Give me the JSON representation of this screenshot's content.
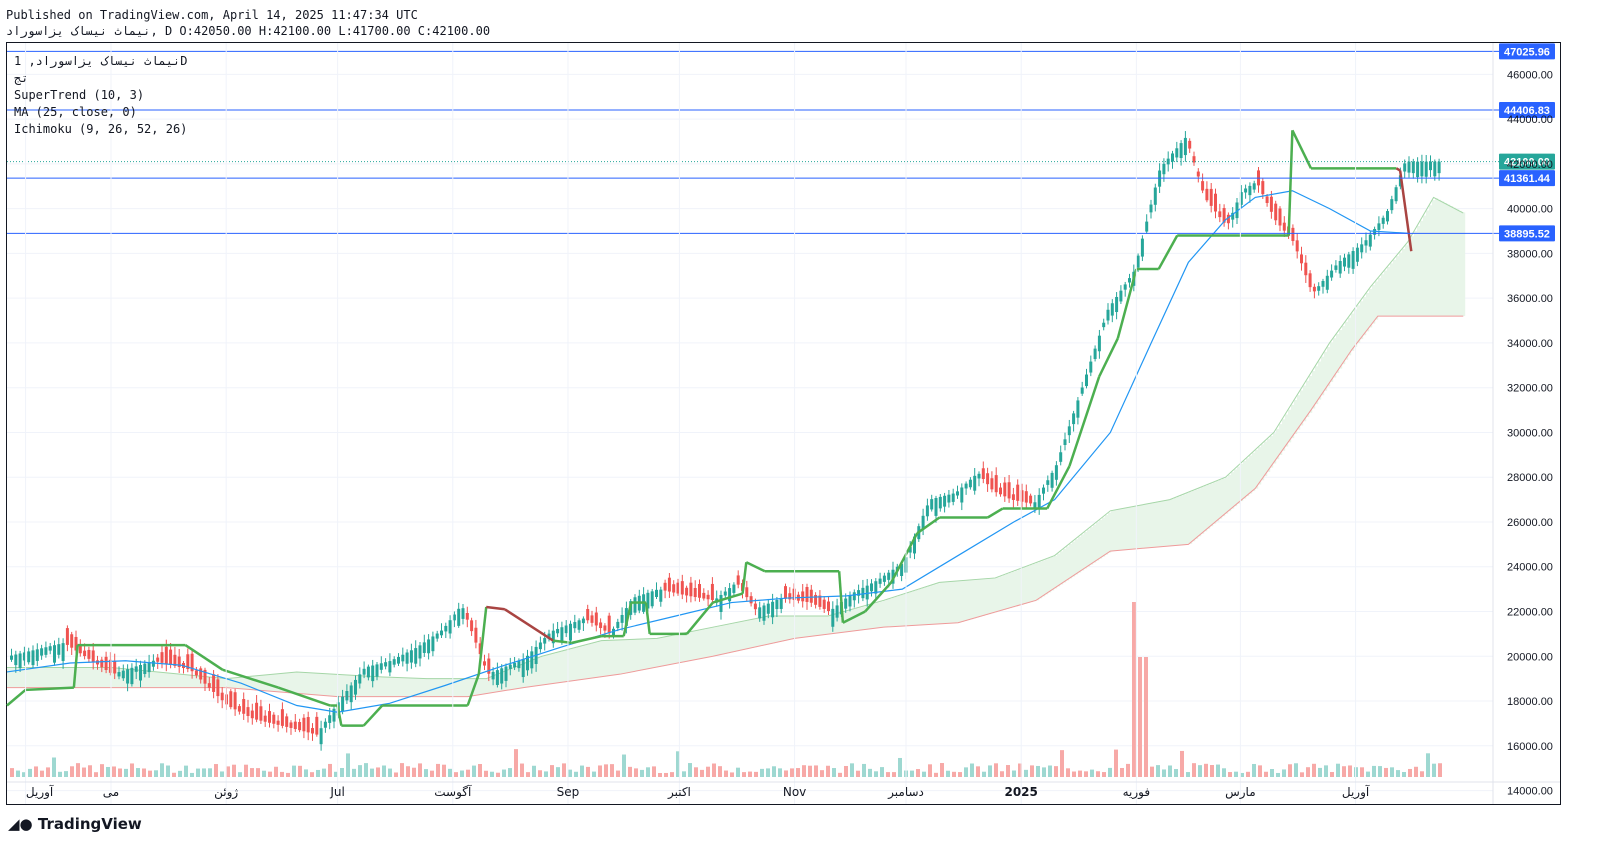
{
  "header": {
    "published": "Published on TradingView.com, April 14, 2025 11:47:34 UTC",
    "ohlc": "نیماث نیساک یزاسوراد, D O:42050.00 H:42100.00 L:41700.00 C:42100.00"
  },
  "legend": {
    "symbol": "نیماث نیساک یزاسوراد, 1D",
    "exchange": "تج",
    "supertrend": "SuperTrend (10, 3)",
    "ma": "MA (25, close, 0)",
    "ichimoku": "Ichimoku (9, 26, 52, 26)"
  },
  "logo": "TradingView",
  "colors": {
    "up": "#26a69a",
    "down": "#ef5350",
    "supertrend_up": "#4caf50",
    "supertrend_down": "#a94442",
    "ma": "#2196f3",
    "hline": "#2962ff",
    "cloud_green": "#e8f5e9",
    "cloud_red": "#fde8e8"
  },
  "chart_data": {
    "type": "candlestick",
    "symbol": "نیماث نیساک یزاسوراد",
    "interval": "1D",
    "ylim": [
      13400,
      47400
    ],
    "y_ticks": [
      14000,
      16000,
      18000,
      20000,
      22000,
      24000,
      26000,
      28000,
      30000,
      32000,
      34000,
      36000,
      38000,
      40000,
      42000,
      44000,
      46000
    ],
    "x_labels": [
      "آوریل",
      "می",
      "ژوئن",
      "Jul",
      "آگوست",
      "Sep",
      "اکتبر",
      "Nov",
      "دسامبر",
      "2025",
      "فوریه",
      "مارس",
      "آوریل"
    ],
    "price_lines": [
      {
        "value": 47025.96,
        "label": "47025.96"
      },
      {
        "value": 44406.83,
        "label": "44406.83"
      },
      {
        "value": 41361.44,
        "label": "41361.44"
      },
      {
        "value": 38895.52,
        "label": "38895.52"
      }
    ],
    "last_price": {
      "value": 42100,
      "label": "42100.00"
    },
    "series": [
      {
        "name": "price",
        "points": [
          [
            "2024-04-08",
            20200
          ],
          [
            "2024-04-18",
            20600
          ],
          [
            "2024-05-01",
            19200
          ],
          [
            "2024-05-12",
            19800
          ],
          [
            "2024-05-22",
            19400
          ],
          [
            "2024-06-01",
            17800
          ],
          [
            "2024-06-08",
            17200
          ],
          [
            "2024-06-18",
            16800
          ],
          [
            "2024-06-25",
            16500
          ],
          [
            "2024-07-01",
            18000
          ],
          [
            "2024-07-08",
            19500
          ],
          [
            "2024-07-15",
            19800
          ],
          [
            "2024-07-22",
            20400
          ],
          [
            "2024-07-29",
            21200
          ],
          [
            "2024-08-03",
            22300
          ],
          [
            "2024-08-10",
            19200
          ],
          [
            "2024-08-20",
            19900
          ],
          [
            "2024-08-27",
            21100
          ],
          [
            "2024-09-05",
            21700
          ],
          [
            "2024-09-12",
            21000
          ],
          [
            "2024-09-18",
            22600
          ],
          [
            "2024-09-25",
            23000
          ],
          [
            "2024-10-03",
            22700
          ],
          [
            "2024-10-10",
            22500
          ],
          [
            "2024-10-16",
            23300
          ],
          [
            "2024-10-21",
            22100
          ],
          [
            "2024-10-28",
            22600
          ],
          [
            "2024-11-05",
            22400
          ],
          [
            "2024-11-10",
            22000
          ],
          [
            "2024-11-16",
            22800
          ],
          [
            "2024-11-23",
            23400
          ],
          [
            "2024-11-30",
            24200
          ],
          [
            "2024-12-07",
            27000
          ],
          [
            "2024-12-14",
            27300
          ],
          [
            "2024-12-20",
            28200
          ],
          [
            "2024-12-24",
            27400
          ],
          [
            "2024-12-29",
            27000
          ],
          [
            "2025-01-04",
            26800
          ],
          [
            "2025-01-10",
            28500
          ],
          [
            "2025-01-17",
            32000
          ],
          [
            "2025-01-24",
            35500
          ],
          [
            "2025-01-31",
            37200
          ],
          [
            "2025-02-07",
            41800
          ],
          [
            "2025-02-14",
            43200
          ],
          [
            "2025-02-19",
            40500
          ],
          [
            "2025-02-25",
            39200
          ],
          [
            "2025-03-01",
            40800
          ],
          [
            "2025-03-05",
            41200
          ],
          [
            "2025-03-10",
            39500
          ],
          [
            "2025-03-15",
            38500
          ],
          [
            "2025-03-20",
            36200
          ],
          [
            "2025-03-27",
            37600
          ],
          [
            "2025-04-03",
            38500
          ],
          [
            "2025-04-09",
            39800
          ],
          [
            "2025-04-14",
            42100
          ]
        ]
      },
      {
        "name": "SuperTrend",
        "points": [
          [
            "2024-04-03",
            17800
          ],
          [
            "2024-04-08",
            18500
          ],
          [
            "2024-04-21",
            18600
          ],
          [
            "2024-04-22",
            20500
          ],
          [
            "2024-05-21",
            20500
          ],
          [
            "2024-05-31",
            19400
          ],
          [
            "2024-06-15",
            18600
          ],
          [
            "2024-06-29",
            17800
          ],
          [
            "2024-07-01",
            17800
          ],
          [
            "2024-07-02",
            16900
          ],
          [
            "2024-07-08",
            16900
          ],
          [
            "2024-07-13",
            17800
          ],
          [
            "2024-08-05",
            17800
          ],
          [
            "2024-08-08",
            19200
          ],
          [
            "2024-08-10",
            22200
          ],
          [
            "2024-08-15",
            22100
          ],
          [
            "2024-08-28",
            20700
          ],
          [
            "2024-09-02",
            20600
          ],
          [
            "2024-09-10",
            20900
          ],
          [
            "2024-09-16",
            20900
          ],
          [
            "2024-09-18",
            22400
          ],
          [
            "2024-09-22",
            22400
          ],
          [
            "2024-09-23",
            21000
          ],
          [
            "2024-10-03",
            21000
          ],
          [
            "2024-10-10",
            22400
          ],
          [
            "2024-10-18",
            22800
          ],
          [
            "2024-10-19",
            24200
          ],
          [
            "2024-10-24",
            23800
          ],
          [
            "2024-11-13",
            23800
          ],
          [
            "2024-11-14",
            21500
          ],
          [
            "2024-11-20",
            22000
          ],
          [
            "2024-11-27",
            23300
          ],
          [
            "2024-12-04",
            25500
          ],
          [
            "2024-12-10",
            26200
          ],
          [
            "2024-12-23",
            26200
          ],
          [
            "2024-12-27",
            26600
          ],
          [
            "2025-01-08",
            26600
          ],
          [
            "2025-01-14",
            28500
          ],
          [
            "2025-01-22",
            32500
          ],
          [
            "2025-01-27",
            34200
          ],
          [
            "2025-02-01",
            37300
          ],
          [
            "2025-02-07",
            37300
          ],
          [
            "2025-02-12",
            38800
          ],
          [
            "2025-03-14",
            38800
          ],
          [
            "2025-03-15",
            43500
          ],
          [
            "2025-03-20",
            41800
          ],
          [
            "2025-04-12",
            41800
          ],
          [
            "2025-04-13",
            41700
          ],
          [
            "2025-04-16",
            38100
          ]
        ]
      },
      {
        "name": "MA",
        "points": [
          [
            "2024-04-03",
            19300
          ],
          [
            "2024-04-20",
            19700
          ],
          [
            "2024-05-05",
            19800
          ],
          [
            "2024-05-20",
            19600
          ],
          [
            "2024-06-05",
            18800
          ],
          [
            "2024-06-20",
            17800
          ],
          [
            "2024-07-01",
            17500
          ],
          [
            "2024-07-15",
            17900
          ],
          [
            "2024-07-30",
            18700
          ],
          [
            "2024-08-15",
            19600
          ],
          [
            "2024-08-30",
            20400
          ],
          [
            "2024-09-15",
            21200
          ],
          [
            "2024-09-30",
            21800
          ],
          [
            "2024-10-15",
            22400
          ],
          [
            "2024-10-30",
            22600
          ],
          [
            "2024-11-15",
            22700
          ],
          [
            "2024-11-30",
            23000
          ],
          [
            "2024-12-15",
            24500
          ],
          [
            "2024-12-30",
            26000
          ],
          [
            "2025-01-10",
            27000
          ],
          [
            "2025-01-25",
            30000
          ],
          [
            "2025-02-05",
            34000
          ],
          [
            "2025-02-15",
            37600
          ],
          [
            "2025-02-25",
            39500
          ],
          [
            "2025-03-05",
            40500
          ],
          [
            "2025-03-15",
            40800
          ],
          [
            "2025-03-25",
            40000
          ],
          [
            "2025-04-05",
            39000
          ],
          [
            "2025-04-15",
            38900
          ]
        ]
      },
      {
        "name": "Senkou A",
        "points": [
          [
            "2024-04-03",
            19500
          ],
          [
            "2024-05-01",
            19500
          ],
          [
            "2024-06-01",
            19000
          ],
          [
            "2024-06-20",
            19300
          ],
          [
            "2024-07-10",
            19100
          ],
          [
            "2024-07-25",
            19000
          ],
          [
            "2024-08-10",
            19000
          ],
          [
            "2024-08-25",
            20000
          ],
          [
            "2024-09-10",
            20700
          ],
          [
            "2024-09-25",
            20800
          ],
          [
            "2024-10-10",
            21300
          ],
          [
            "2024-10-25",
            21800
          ],
          [
            "2024-11-10",
            21800
          ],
          [
            "2024-11-25",
            22500
          ],
          [
            "2024-12-10",
            23300
          ],
          [
            "2024-12-25",
            23500
          ],
          [
            "2025-01-10",
            24500
          ],
          [
            "2025-01-25",
            26500
          ],
          [
            "2025-02-10",
            27000
          ],
          [
            "2025-02-25",
            28000
          ],
          [
            "2025-03-10",
            30000
          ],
          [
            "2025-03-25",
            34000
          ],
          [
            "2025-04-05",
            36500
          ],
          [
            "2025-04-15",
            38500
          ],
          [
            "2025-04-22",
            40500
          ],
          [
            "2025-04-30",
            39800
          ]
        ]
      },
      {
        "name": "Senkou B",
        "points": [
          [
            "2024-04-03",
            18600
          ],
          [
            "2024-06-01",
            18600
          ],
          [
            "2024-07-01",
            18200
          ],
          [
            "2024-08-05",
            18200
          ],
          [
            "2024-08-20",
            18600
          ],
          [
            "2024-09-15",
            19200
          ],
          [
            "2024-10-10",
            20000
          ],
          [
            "2024-11-01",
            20800
          ],
          [
            "2024-11-25",
            21300
          ],
          [
            "2024-12-15",
            21500
          ],
          [
            "2025-01-05",
            22500
          ],
          [
            "2025-01-25",
            24700
          ],
          [
            "2025-02-15",
            25000
          ],
          [
            "2025-03-05",
            27500
          ],
          [
            "2025-03-20",
            31000
          ],
          [
            "2025-03-31",
            33700
          ],
          [
            "2025-04-07",
            35200
          ],
          [
            "2025-04-30",
            35200
          ]
        ]
      }
    ]
  }
}
